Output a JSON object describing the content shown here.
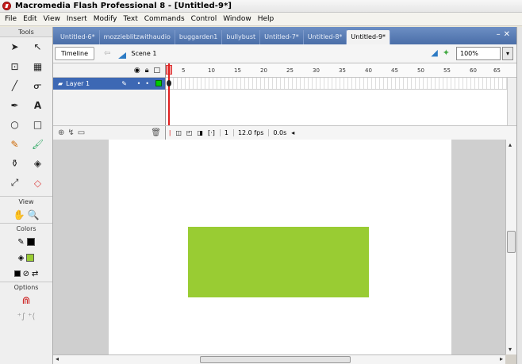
{
  "window": {
    "title": "Macromedia Flash Professional 8 - [Untitled-9*]"
  },
  "menu": [
    "File",
    "Edit",
    "View",
    "Insert",
    "Modify",
    "Text",
    "Commands",
    "Control",
    "Window",
    "Help"
  ],
  "tools": {
    "header": "Tools",
    "view_label": "View",
    "colors_label": "Colors",
    "options_label": "Options"
  },
  "doc_tabs": [
    "Untitled-6*",
    "mozzieblitzwithaudio",
    "buggarden1",
    "bullybust",
    "Untitled-7*",
    "Untitled-8*",
    "Untitled-9*"
  ],
  "active_tab": "Untitled-9*",
  "editbar": {
    "timeline_button": "Timeline",
    "scene": "Scene 1",
    "zoom": "100%"
  },
  "timeline": {
    "layer_name": "Layer 1",
    "ruler": [
      "5",
      "10",
      "15",
      "20",
      "25",
      "30",
      "35",
      "40",
      "45",
      "50",
      "55",
      "60",
      "65"
    ],
    "current_frame": "1",
    "fps": "12.0 fps",
    "time": "0.0s"
  },
  "stage": {
    "rect_color": "#99cc33"
  }
}
